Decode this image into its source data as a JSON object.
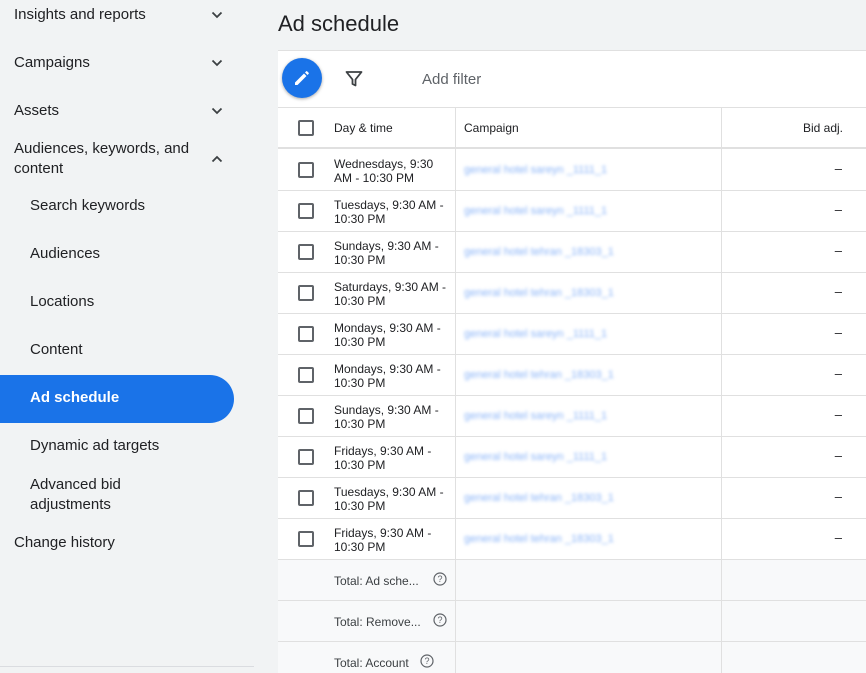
{
  "sidebar": {
    "items": [
      {
        "label": "Insights and reports",
        "expanded": false
      },
      {
        "label": "Campaigns",
        "expanded": false
      },
      {
        "label": "Assets",
        "expanded": false
      },
      {
        "label": "Audiences, keywords, and content",
        "expanded": true
      }
    ],
    "sub_items": [
      {
        "label": "Search keywords"
      },
      {
        "label": "Audiences"
      },
      {
        "label": "Locations"
      },
      {
        "label": "Content"
      },
      {
        "label": "Ad schedule",
        "active": true
      },
      {
        "label": "Dynamic ad targets"
      },
      {
        "label": "Advanced bid adjustments"
      }
    ],
    "change_history": "Change history",
    "active_color": "#1a73e8"
  },
  "page": {
    "title": "Ad schedule"
  },
  "toolbar": {
    "edit_icon": "pencil-icon",
    "filter_icon": "filter-icon",
    "add_filter": "Add filter"
  },
  "table": {
    "headers": {
      "day_time": "Day & time",
      "campaign": "Campaign",
      "bid_adj": "Bid adj."
    },
    "rows": [
      {
        "day_time": "Wednesdays, 9:30 AM - 10:30 PM",
        "campaign": "general hotel sareyn _1111_1",
        "bid_adj": "–"
      },
      {
        "day_time": "Tuesdays, 9:30 AM - 10:30 PM",
        "campaign": "general hotel sareyn _1111_1",
        "bid_adj": "–"
      },
      {
        "day_time": "Sundays, 9:30 AM - 10:30 PM",
        "campaign": "general hotel tehran _18303_1",
        "bid_adj": "–"
      },
      {
        "day_time": "Saturdays, 9:30 AM - 10:30 PM",
        "campaign": "general hotel tehran _18303_1",
        "bid_adj": "–"
      },
      {
        "day_time": "Mondays, 9:30 AM - 10:30 PM",
        "campaign": "general hotel sareyn _1111_1",
        "bid_adj": "–"
      },
      {
        "day_time": "Mondays, 9:30 AM - 10:30 PM",
        "campaign": "general hotel tehran _18303_1",
        "bid_adj": "–"
      },
      {
        "day_time": "Sundays, 9:30 AM - 10:30 PM",
        "campaign": "general hotel sareyn _1111_1",
        "bid_adj": "–"
      },
      {
        "day_time": "Fridays, 9:30 AM - 10:30 PM",
        "campaign": "general hotel sareyn _1111_1",
        "bid_adj": "–"
      },
      {
        "day_time": "Tuesdays, 9:30 AM - 10:30 PM",
        "campaign": "general hotel tehran _18303_1",
        "bid_adj": "–"
      },
      {
        "day_time": "Fridays, 9:30 AM - 10:30 PM",
        "campaign": "general hotel tehran _18303_1",
        "bid_adj": "–"
      }
    ],
    "totals": [
      {
        "label": "Total: Ad sche...",
        "icon": "help-icon"
      },
      {
        "label": "Total: Remove...",
        "icon": "help-icon"
      },
      {
        "label": "Total: Account",
        "icon": "help-icon"
      }
    ]
  }
}
